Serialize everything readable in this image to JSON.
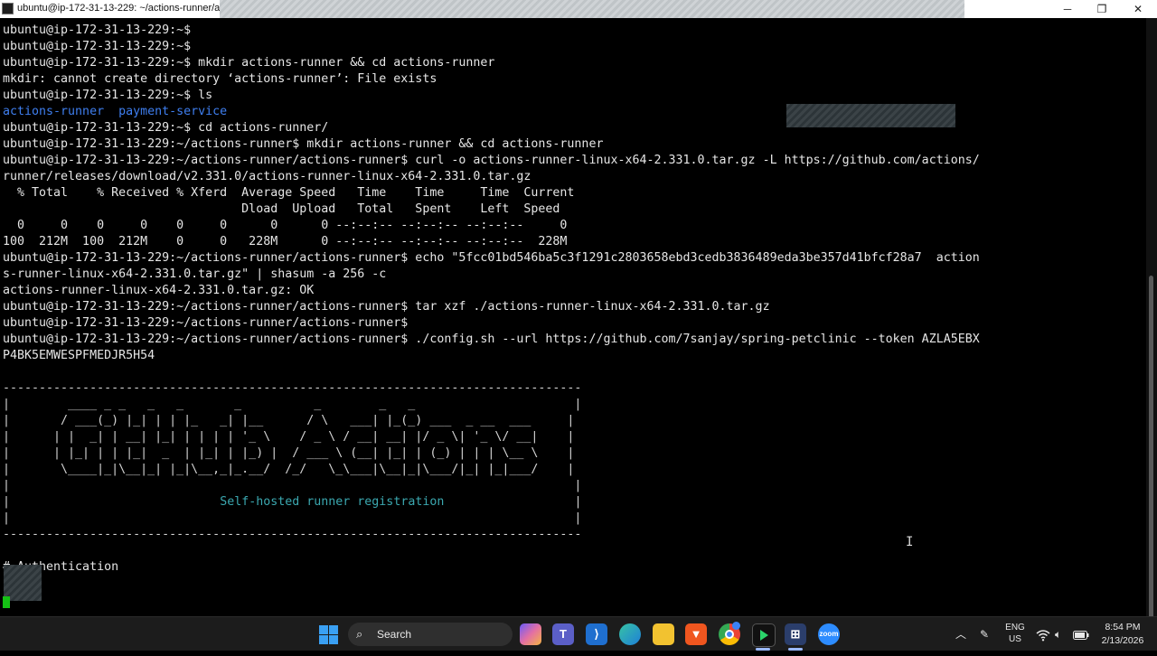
{
  "window": {
    "title": "ubuntu@ip-172-31-13-229: ~/actions-runner/actio",
    "controls": {
      "minimize": "─",
      "maximize": "❐",
      "close": "✕"
    }
  },
  "terminal": {
    "lines": [
      "ubuntu@ip-172-31-13-229:~$",
      "ubuntu@ip-172-31-13-229:~$",
      "ubuntu@ip-172-31-13-229:~$ mkdir actions-runner && cd actions-runner",
      "mkdir: cannot create directory ‘actions-runner’: File exists",
      "ubuntu@ip-172-31-13-229:~$ ls",
      "",
      "ubuntu@ip-172-31-13-229:~$ cd actions-runner/",
      "ubuntu@ip-172-31-13-229:~/actions-runner$ mkdir actions-runner && cd actions-runner",
      "ubuntu@ip-172-31-13-229:~/actions-runner/actions-runner$ curl -o actions-runner-linux-x64-2.331.0.tar.gz -L https://github.com/actions/",
      "runner/releases/download/v2.331.0/actions-runner-linux-x64-2.331.0.tar.gz",
      "  % Total    % Received % Xferd  Average Speed   Time    Time     Time  Current",
      "                                 Dload  Upload   Total   Spent    Left  Speed",
      "  0     0    0     0    0     0      0      0 --:--:-- --:--:-- --:--:--     0",
      "100  212M  100  212M    0     0   228M      0 --:--:-- --:--:-- --:--:--  228M",
      "ubuntu@ip-172-31-13-229:~/actions-runner/actions-runner$ echo \"5fcc01bd546ba5c3f1291c2803658ebd3cedb3836489eda3be357d41bfcf28a7  action",
      "s-runner-linux-x64-2.331.0.tar.gz\" | shasum -a 256 -c",
      "actions-runner-linux-x64-2.331.0.tar.gz: OK",
      "ubuntu@ip-172-31-13-229:~/actions-runner/actions-runner$ tar xzf ./actions-runner-linux-x64-2.331.0.tar.gz",
      "ubuntu@ip-172-31-13-229:~/actions-runner/actions-runner$",
      "ubuntu@ip-172-31-13-229:~/actions-runner/actions-runner$ ./config.sh --url https://github.com/7sanjay/spring-petclinic --token AZLA5EBX",
      "P4BK5EMWESPFMEDJR5H54",
      "",
      "--------------------------------------------------------------------------------",
      "|        ____ _ _   _   _       _          _        _   _                      |",
      "|       / ___(_) |_| | | |_   _| |__      / \\   ___| |_(_) ___  _ __  ___     |",
      "|      | |  _| | __| |_| | | | | '_ \\    / _ \\ / __| __| |/ _ \\| '_ \\/ __|    |",
      "|      | |_| | | |_|  _  | |_| | |_) |  / ___ \\ (__| |_| | (_) | | | \\__ \\    |",
      "|       \\____|_|\\__|_| |_|\\__,_|_.__/  /_/   \\_\\___|\\__|_|\\___/|_| |_|___/    |",
      "|                                                                              |",
      "",
      "|                                                                              |",
      "--------------------------------------------------------------------------------",
      "",
      "# Authentication"
    ],
    "ls_output": [
      "actions-runner",
      "payment-service"
    ],
    "banner_subtitle": "Self-hosted runner registration",
    "banner_border_left": "|",
    "banner_border_right": "|"
  },
  "taskbar": {
    "search_label": "Search",
    "search_icon": "search-icon",
    "apps": [
      "copilot",
      "teams",
      "vscode",
      "edge",
      "file-explorer",
      "brave",
      "chrome",
      "app",
      "putty",
      "zoom"
    ],
    "zoom_label": "zoom",
    "language": "ENG",
    "region": "US",
    "time": "8:54 PM",
    "date": "2/13/2026"
  },
  "colors": {
    "terminal_bg": "#000000",
    "terminal_fg": "#e6e6e6",
    "directory": "#3f7ff0",
    "banner_subtitle": "#3ba8b0",
    "cursor": "#15c115",
    "taskbar_bg": "#1c1c1c"
  }
}
